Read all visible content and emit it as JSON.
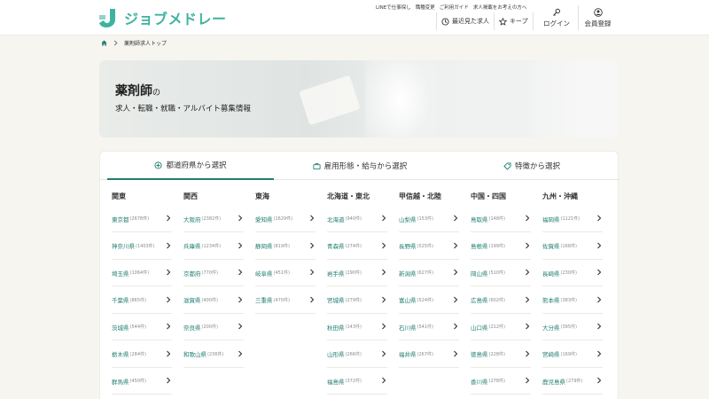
{
  "brand": {
    "name": "ジョブメドレー",
    "color": "#3fb2a0"
  },
  "header": {
    "util_links": [
      "LINEで仕事探し",
      "職種変更",
      "ご利用ガイド",
      "求人掲載をお考えの方へ"
    ],
    "recent_label": "最近見た求人",
    "keep_label": "キープ",
    "login_label": "ログイン",
    "register_label": "会員登録"
  },
  "breadcrumb": {
    "current": "薬剤師求人トップ"
  },
  "hero": {
    "title": "薬剤師",
    "title_suffix": "の",
    "subtitle": "求人・転職・就職・アルバイト募集情報"
  },
  "tabs": [
    {
      "label": "都道府県から選択",
      "icon": "map-pin-icon",
      "active": true
    },
    {
      "label": "雇用形態・給与から選択",
      "icon": "briefcase-icon",
      "active": false
    },
    {
      "label": "特徴から選択",
      "icon": "tag-icon",
      "active": false
    }
  ],
  "regions": [
    {
      "name": "関東",
      "prefs": [
        {
          "name": "東京都",
          "count": "(2678件)"
        },
        {
          "name": "神奈川県",
          "count": "(1403件)"
        },
        {
          "name": "埼玉県",
          "count": "(1064件)"
        },
        {
          "name": "千葉県",
          "count": "(865件)"
        },
        {
          "name": "茨城県",
          "count": "(544件)"
        },
        {
          "name": "栃木県",
          "count": "(284件)"
        },
        {
          "name": "群馬県",
          "count": "(450件)"
        }
      ]
    },
    {
      "name": "関西",
      "prefs": [
        {
          "name": "大阪府",
          "count": "(2382件)"
        },
        {
          "name": "兵庫県",
          "count": "(1234件)"
        },
        {
          "name": "京都府",
          "count": "(770件)"
        },
        {
          "name": "滋賀県",
          "count": "(400件)"
        },
        {
          "name": "奈良県",
          "count": "(200件)"
        },
        {
          "name": "和歌山県",
          "count": "(236件)"
        }
      ]
    },
    {
      "name": "東海",
      "prefs": [
        {
          "name": "愛知県",
          "count": "(1629件)"
        },
        {
          "name": "静岡県",
          "count": "(819件)"
        },
        {
          "name": "岐阜県",
          "count": "(451件)"
        },
        {
          "name": "三重県",
          "count": "(470件)"
        }
      ]
    },
    {
      "name": "北海道・東北",
      "prefs": [
        {
          "name": "北海道",
          "count": "(940件)"
        },
        {
          "name": "青森県",
          "count": "(274件)"
        },
        {
          "name": "岩手県",
          "count": "(290件)"
        },
        {
          "name": "宮城県",
          "count": "(279件)"
        },
        {
          "name": "秋田県",
          "count": "(143件)"
        },
        {
          "name": "山形県",
          "count": "(266件)"
        },
        {
          "name": "福島県",
          "count": "(372件)"
        }
      ]
    },
    {
      "name": "甲信越・北陸",
      "prefs": [
        {
          "name": "山梨県",
          "count": "(153件)"
        },
        {
          "name": "長野県",
          "count": "(525件)"
        },
        {
          "name": "新潟県",
          "count": "(627件)"
        },
        {
          "name": "富山県",
          "count": "(524件)"
        },
        {
          "name": "石川県",
          "count": "(541件)"
        },
        {
          "name": "福井県",
          "count": "(267件)"
        }
      ]
    },
    {
      "name": "中国・四国",
      "prefs": [
        {
          "name": "鳥取県",
          "count": "(148件)"
        },
        {
          "name": "島根県",
          "count": "(199件)"
        },
        {
          "name": "岡山県",
          "count": "(510件)"
        },
        {
          "name": "広島県",
          "count": "(602件)"
        },
        {
          "name": "山口県",
          "count": "(212件)"
        },
        {
          "name": "徳島県",
          "count": "(228件)"
        },
        {
          "name": "香川県",
          "count": "(278件)"
        }
      ]
    },
    {
      "name": "九州・沖縄",
      "prefs": [
        {
          "name": "福岡県",
          "count": "(1121件)"
        },
        {
          "name": "佐賀県",
          "count": "(168件)"
        },
        {
          "name": "長崎県",
          "count": "(230件)"
        },
        {
          "name": "熊本県",
          "count": "(383件)"
        },
        {
          "name": "大分県",
          "count": "(395件)"
        },
        {
          "name": "宮崎県",
          "count": "(169件)"
        },
        {
          "name": "鹿児島県",
          "count": "(279件)"
        }
      ]
    }
  ]
}
